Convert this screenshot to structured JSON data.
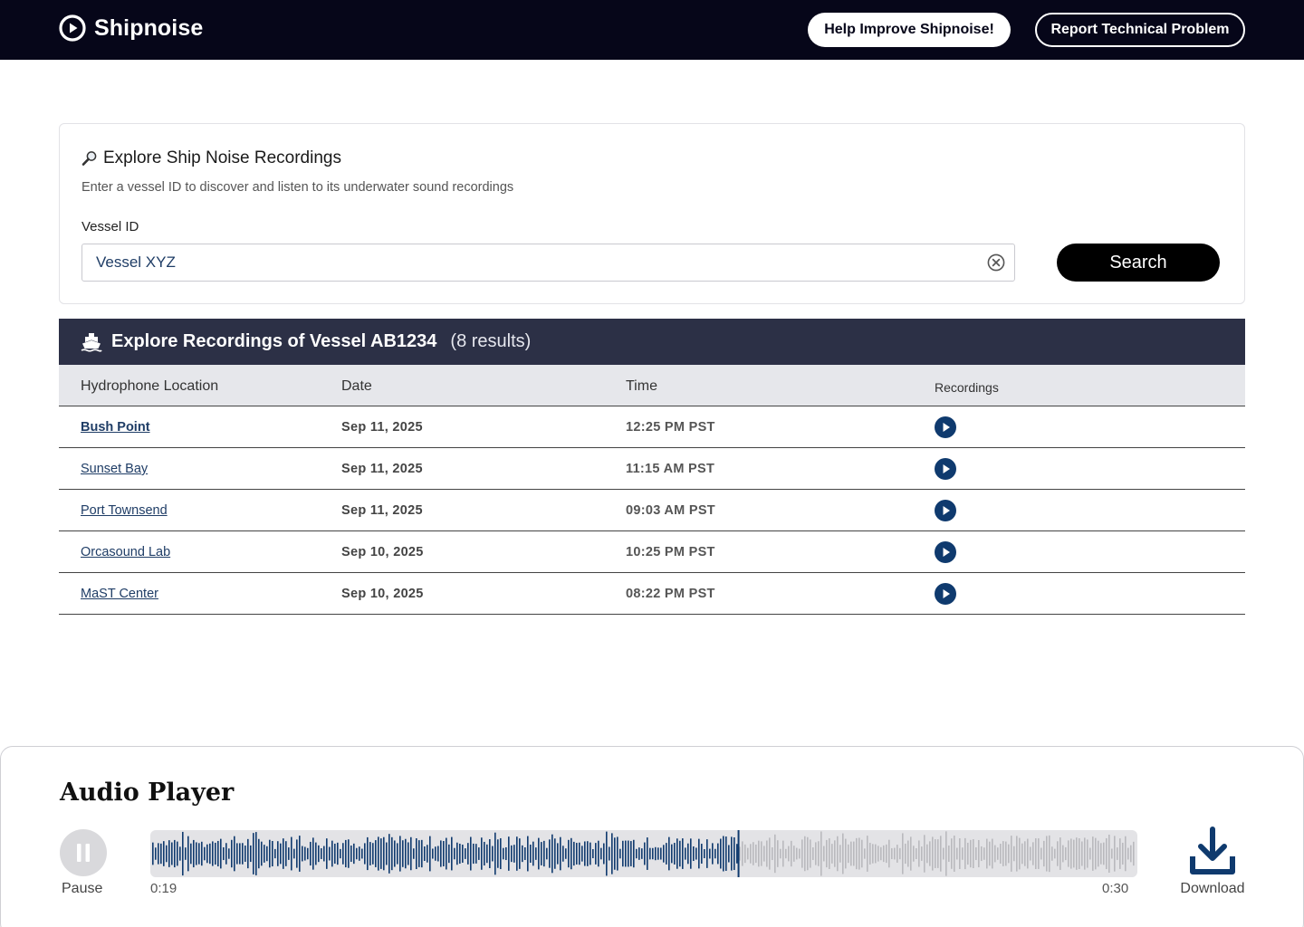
{
  "header": {
    "brand": "Shipnoise",
    "help_button": "Help Improve Shipnoise!",
    "report_button": "Report Technical Problem",
    "background": "#060619"
  },
  "search": {
    "icon": "magnifying-glass-icon",
    "title": "Explore Ship Noise Recordings",
    "subtitle": "Enter a vessel ID to discover and listen to its underwater sound recordings",
    "field_label": "Vessel ID",
    "field_value": "Vessel XYZ",
    "button_label": "Search"
  },
  "results": {
    "icon": "ship-icon",
    "title": "Explore Recordings of Vessel AB1234",
    "count": "(8 results)",
    "header_background": "#2c3046",
    "columns": [
      "Hydrophone Location",
      "Date",
      "Time",
      "Recordings"
    ],
    "rows": [
      {
        "location": "Bush Point",
        "date": "Sep 11, 2025",
        "time": "12:25 PM PST"
      },
      {
        "location": "Sunset Bay",
        "date": "Sep 11, 2025",
        "time": "11:15 AM PST"
      },
      {
        "location": "Port Townsend",
        "date": "Sep 11, 2025",
        "time": "09:03 AM PST"
      },
      {
        "location": "Orcasound Lab",
        "date": "Sep 10, 2025",
        "time": "10:25 PM PST"
      },
      {
        "location": "MaST Center",
        "date": "Sep 10, 2025",
        "time": "08:22 PM PST"
      }
    ]
  },
  "player": {
    "title": "Audio Player",
    "pause_label": "Pause",
    "current_time": "0:19",
    "total_time": "0:30",
    "progress_fraction": 0.595,
    "download_label": "Download",
    "played_color": "#0f3a6e",
    "unplayed_color": "#b9b9bd"
  }
}
